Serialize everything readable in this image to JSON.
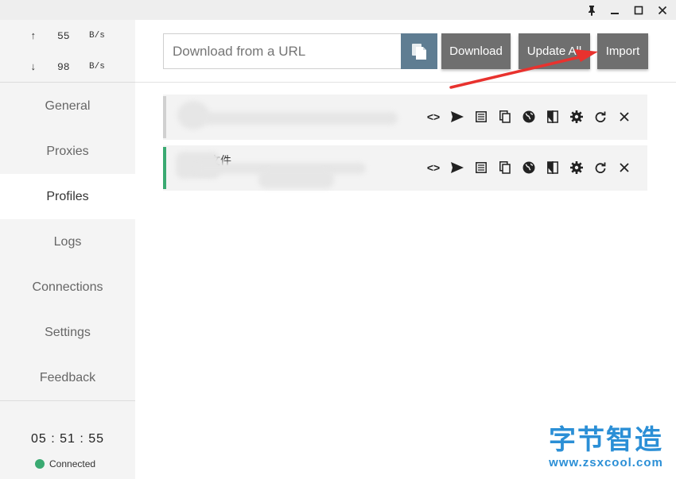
{
  "titlebar": {
    "icons": [
      "pin-icon",
      "minimize-icon",
      "maximize-icon",
      "close-icon"
    ]
  },
  "traffic": {
    "up": {
      "arrow": "↑",
      "value": "55",
      "unit": "B/s"
    },
    "down": {
      "arrow": "↓",
      "value": "98",
      "unit": "B/s"
    }
  },
  "nav": {
    "items": [
      {
        "label": "General",
        "active": false
      },
      {
        "label": "Proxies",
        "active": false
      },
      {
        "label": "Profiles",
        "active": true
      },
      {
        "label": "Logs",
        "active": false
      },
      {
        "label": "Connections",
        "active": false
      },
      {
        "label": "Settings",
        "active": false
      },
      {
        "label": "Feedback",
        "active": false
      }
    ]
  },
  "status": {
    "time": "05 : 51 : 55",
    "connection": "Connected",
    "connected_color": "#3aaa72"
  },
  "toolbar": {
    "url_placeholder": "Download from a URL",
    "download_label": "Download",
    "update_all_label": "Update All",
    "import_label": "Import"
  },
  "profiles": {
    "items": [
      {
        "name": "",
        "selected": false
      },
      {
        "name": "文件",
        "selected": true
      }
    ],
    "action_icons": [
      "code-icon",
      "send-icon",
      "list-icon",
      "copy-icon",
      "globe-icon",
      "compare-icon",
      "gear-icon",
      "refresh-icon",
      "close-icon"
    ]
  },
  "watermark": {
    "cn": "字节智造",
    "url": "www.zsxcool.com"
  },
  "colors": {
    "accent": "#5f7d92",
    "button_gray": "#6f6f6f",
    "annotation_red": "#e8322e",
    "watermark_blue": "#2b8fd6"
  }
}
